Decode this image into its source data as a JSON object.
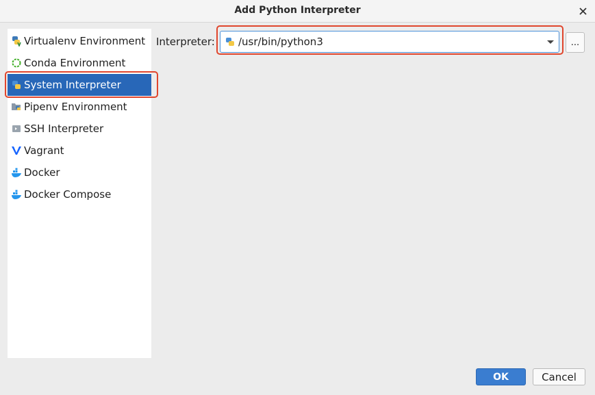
{
  "window": {
    "title": "Add Python Interpreter"
  },
  "sidebar": {
    "items": [
      {
        "label": "Virtualenv Environment",
        "icon": "python-virtualenv-icon"
      },
      {
        "label": "Conda Environment",
        "icon": "conda-icon"
      },
      {
        "label": "System Interpreter",
        "icon": "python-icon",
        "selected": true
      },
      {
        "label": "Pipenv Environment",
        "icon": "pipenv-icon"
      },
      {
        "label": "SSH Interpreter",
        "icon": "ssh-icon"
      },
      {
        "label": "Vagrant",
        "icon": "vagrant-icon"
      },
      {
        "label": "Docker",
        "icon": "docker-icon"
      },
      {
        "label": "Docker Compose",
        "icon": "docker-compose-icon"
      }
    ]
  },
  "main": {
    "interpreter_label": "Interpreter:",
    "interpreter_value": "/usr/bin/python3",
    "browse_label": "..."
  },
  "footer": {
    "ok_label": "OK",
    "cancel_label": "Cancel"
  },
  "colors": {
    "selection": "#2867b8",
    "highlight": "#e0452c",
    "ok_button": "#3a7dd0",
    "background": "#ececec"
  }
}
